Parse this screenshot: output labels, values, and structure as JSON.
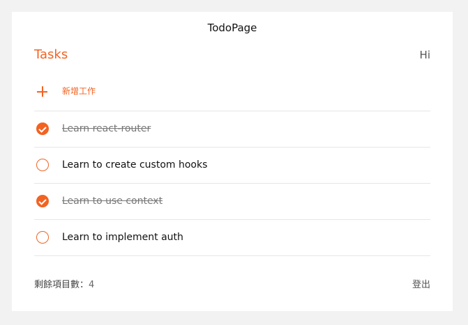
{
  "app": {
    "title": "TodoPage"
  },
  "header": {
    "title": "Tasks",
    "greeting": "Hi"
  },
  "add_task": {
    "icon": "plus-icon",
    "label": "新增工作"
  },
  "todos": [
    {
      "text": "Learn react-router",
      "completed": true
    },
    {
      "text": "Learn to create custom hooks",
      "completed": false
    },
    {
      "text": "Learn to use context",
      "completed": true
    },
    {
      "text": "Learn to implement auth",
      "completed": false
    }
  ],
  "footer": {
    "remaining_label": "剩餘項目數：",
    "remaining_count": "4",
    "logout_label": "登出"
  },
  "colors": {
    "accent": "#f26322",
    "background": "#f2f2f2",
    "card": "#ffffff",
    "divider": "#e6e6e6"
  }
}
